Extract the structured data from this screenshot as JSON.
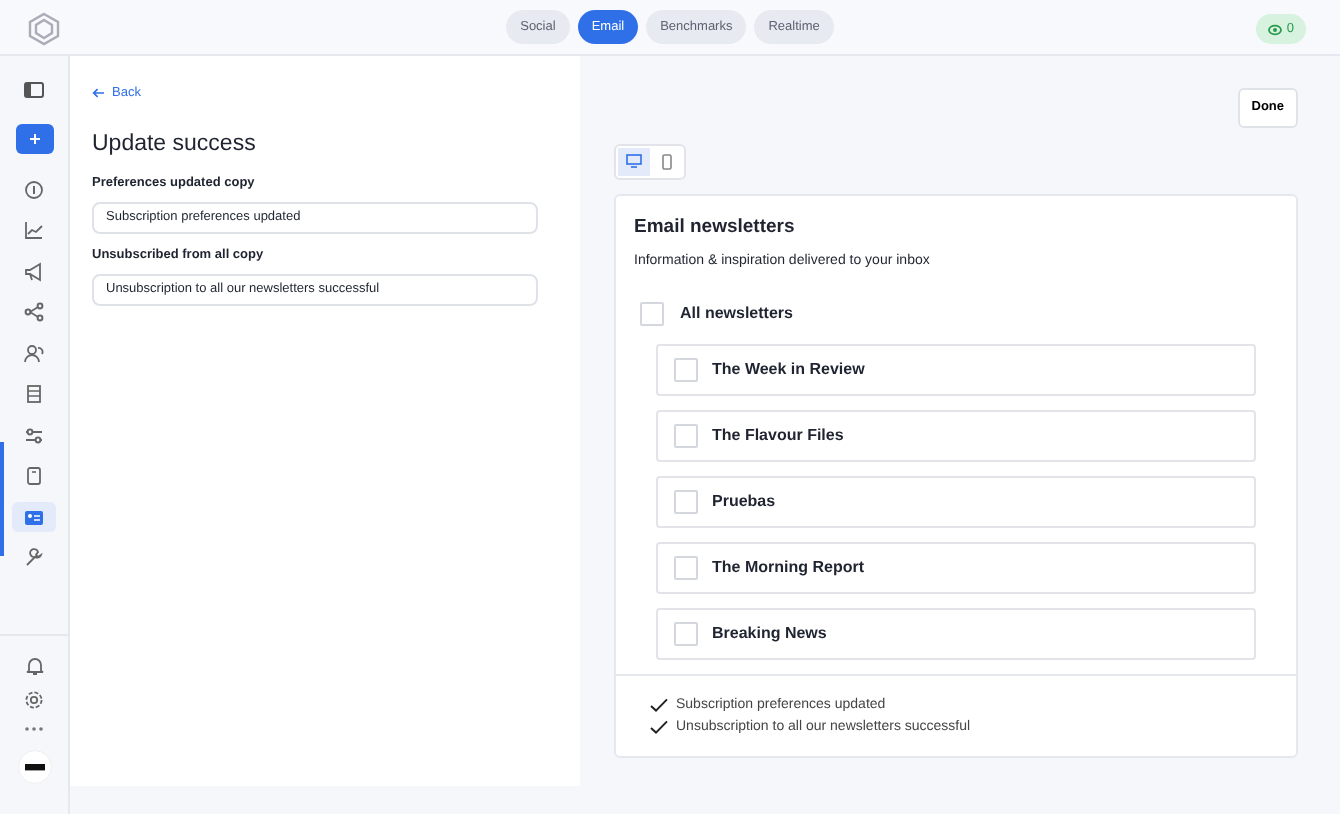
{
  "top_tabs": [
    {
      "label": "Social",
      "selected": false
    },
    {
      "label": "Email",
      "selected": true
    },
    {
      "label": "Benchmarks",
      "selected": false
    },
    {
      "label": "Realtime",
      "selected": false
    }
  ],
  "views_badge": "0",
  "sidebar": {
    "items": [
      {
        "selected": false
      },
      {
        "selected": false
      },
      {
        "selected": false
      },
      {
        "selected": false
      },
      {
        "selected": false
      },
      {
        "selected": false
      },
      {
        "selected": false
      },
      {
        "selected": false
      },
      {
        "selected": true
      },
      {
        "selected": false
      }
    ]
  },
  "editor": {
    "back": "Back",
    "title": "Update success",
    "fields": [
      {
        "label": "Preferences updated copy",
        "value": "Subscription preferences updated"
      },
      {
        "label": "Unsubscribed from all copy",
        "value": "Unsubscription to all our newsletters successful"
      }
    ]
  },
  "preview": {
    "done": "Done",
    "devices": [
      {
        "selected": true
      },
      {
        "selected": false
      }
    ],
    "title": "Email newsletters",
    "subtitle": "Information & inspiration delivered to your inbox",
    "all": {
      "label": "All newsletters",
      "checked": false
    },
    "newsletters": [
      {
        "label": "The Week in Review",
        "checked": false
      },
      {
        "label": "The Flavour Files",
        "checked": false
      },
      {
        "label": "Pruebas",
        "checked": false
      },
      {
        "label": "The Morning Report",
        "checked": false
      },
      {
        "label": "Breaking News",
        "checked": false
      }
    ],
    "messages": [
      "Subscription preferences updated",
      "Unsubscription to all our newsletters successful"
    ]
  }
}
